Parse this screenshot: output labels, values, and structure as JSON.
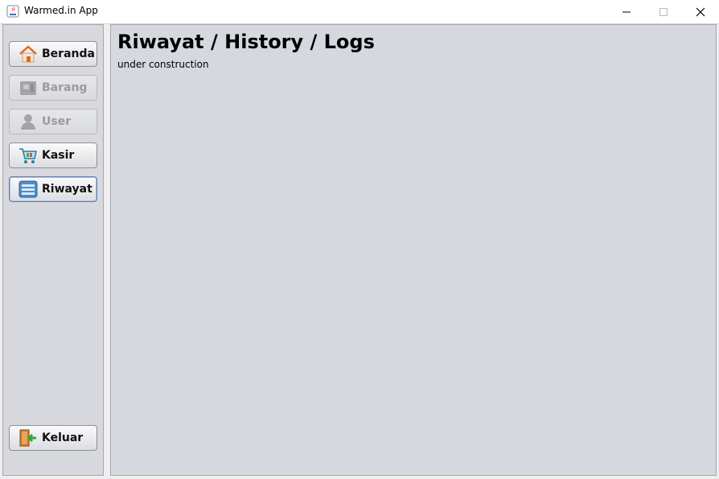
{
  "window": {
    "title": "Warmed.in App"
  },
  "sidebar": {
    "items": [
      {
        "label": "Beranda",
        "icon": "home-icon",
        "enabled": true
      },
      {
        "label": "Barang",
        "icon": "box-icon",
        "enabled": false
      },
      {
        "label": "User",
        "icon": "user-icon",
        "enabled": false
      },
      {
        "label": "Kasir",
        "icon": "cart-icon",
        "enabled": true
      },
      {
        "label": "Riwayat",
        "icon": "history-icon",
        "enabled": true,
        "selected": true
      }
    ],
    "logout": {
      "label": "Keluar",
      "icon": "exit-door-icon"
    }
  },
  "main": {
    "title": "Riwayat / History / Logs",
    "subtitle": "under construction"
  }
}
